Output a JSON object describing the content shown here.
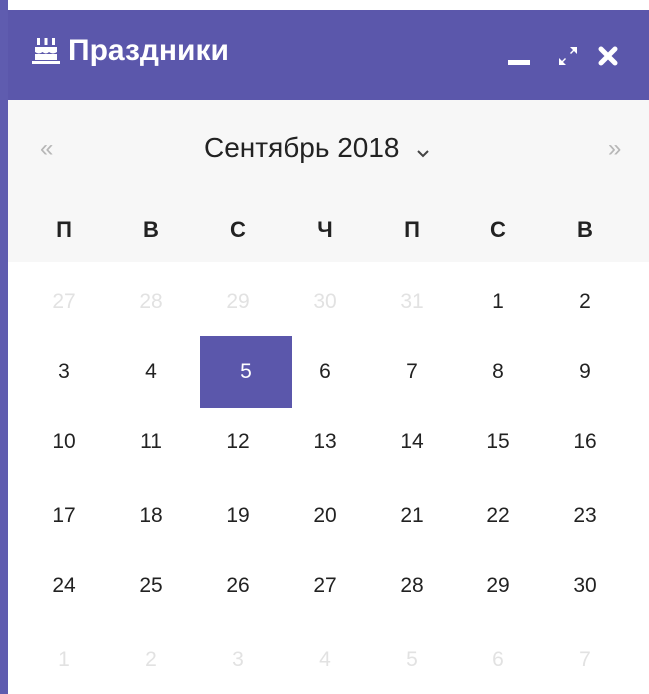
{
  "widget": {
    "title": "Праздники",
    "icon": "cake-icon",
    "controls": [
      "minimize-icon",
      "maximize-icon",
      "close-icon"
    ],
    "accent_color": "#5b57ab"
  },
  "calendar": {
    "prev_label": "«",
    "next_label": "»",
    "month_label": "Сентябрь 2018",
    "weekdays": [
      "П",
      "В",
      "С",
      "Ч",
      "П",
      "С",
      "В"
    ],
    "weeks": [
      [
        "27",
        "28",
        "29",
        "30",
        "31",
        "1",
        "2"
      ],
      [
        "3",
        "4",
        "5",
        "6",
        "7",
        "8",
        "9"
      ],
      [
        "10",
        "11",
        "12",
        "13",
        "14",
        "15",
        "16"
      ],
      [
        "17",
        "18",
        "19",
        "20",
        "21",
        "22",
        "23"
      ],
      [
        "24",
        "25",
        "26",
        "27",
        "28",
        "29",
        "30"
      ],
      [
        "1",
        "2",
        "3",
        "4",
        "5",
        "6",
        "7"
      ]
    ],
    "selected_day": "5"
  }
}
